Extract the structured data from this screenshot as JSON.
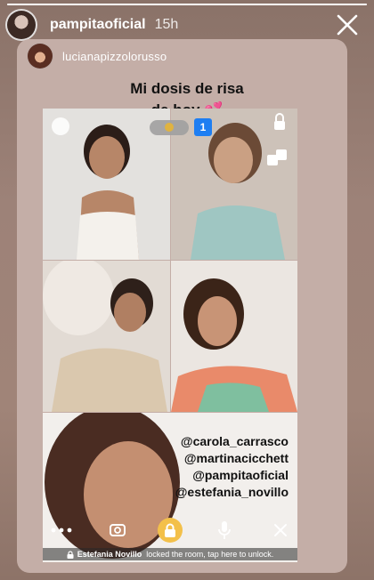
{
  "story": {
    "username": "pampitaoficial",
    "time": "15h",
    "progress_fraction": 1.0
  },
  "repost": {
    "username": "lucianapizzolorusso"
  },
  "caption": {
    "line1": "Mi dosis de risa",
    "line2": "de hoy",
    "emoji": "💕"
  },
  "call": {
    "participant_count": "1",
    "mentions": [
      "@carola_carrasco",
      "@martinacicchett",
      "@pampitaoficial",
      "@estefania_novillo"
    ],
    "locked_by": "Estefania Novillo",
    "locked_message": "locked the room, tap here to unlock.",
    "icons": [
      "emoji-face-icon",
      "add-lock-icon",
      "dice-icon",
      "more-icon",
      "flip-camera-icon",
      "lock-icon",
      "microphone-icon",
      "close-icon"
    ]
  },
  "colors": {
    "lock_button": "#f3c04a",
    "count_badge": "#1e7ef2"
  }
}
